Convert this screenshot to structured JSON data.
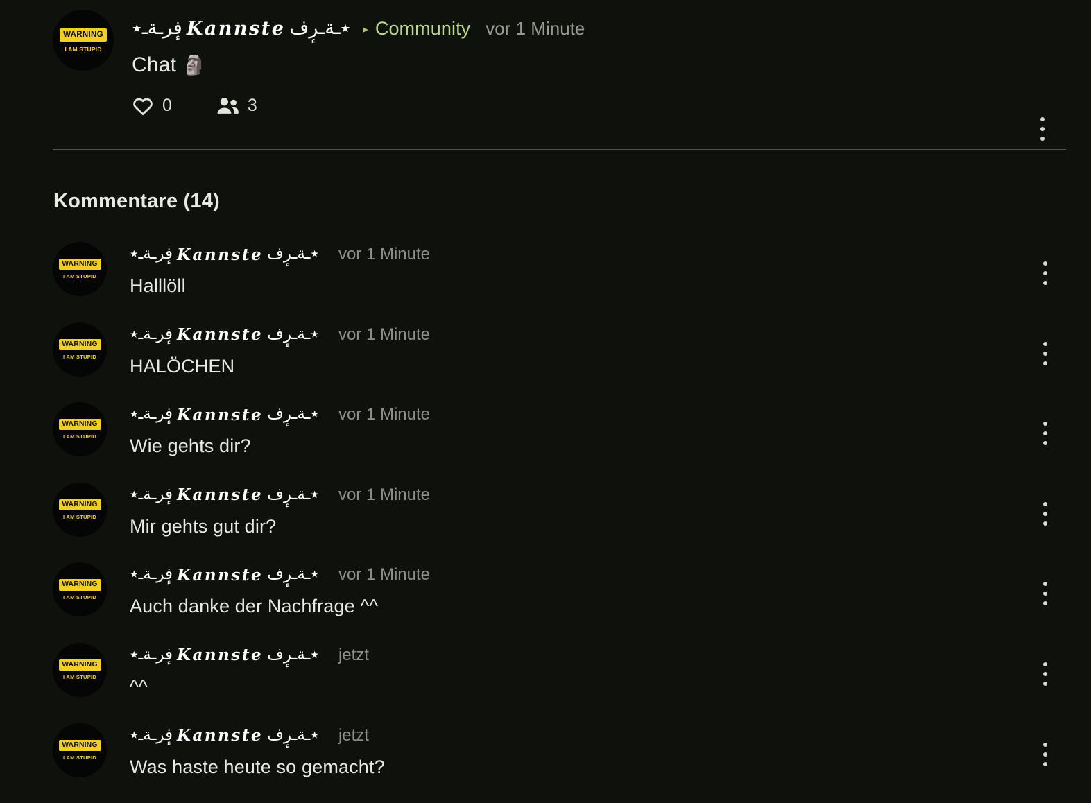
{
  "theme": {
    "background": "#0f110d",
    "text_primary": "#e8e8e4",
    "text_muted": "#9a9a93",
    "accent_green": "#b9d98c",
    "divider": "#4d524a",
    "avatar_yellow": "#f2d022"
  },
  "avatar": {
    "banner_text": "WARNING",
    "sub_text": "I AM STUPID"
  },
  "username": {
    "prefix_flourish": "فٕرـةـ٭",
    "core": "Kannste",
    "suffix_flourish": "٭ـةـرٕف"
  },
  "post": {
    "author": "Kannste",
    "caret": "▸",
    "community_label": "Community",
    "time": "vor 1 Minute",
    "text": "Chat",
    "emoji": "🗿",
    "likes_count": "0",
    "likes_icon": "heart-icon",
    "viewers_count": "3",
    "viewers_icon": "people-icon",
    "menu_icon": "kebab-menu-icon"
  },
  "comments_section": {
    "heading": "Kommentare (14)",
    "count": 14,
    "items": [
      {
        "author": "Kannste",
        "time": "vor 1 Minute",
        "text": "Halllöll"
      },
      {
        "author": "Kannste",
        "time": "vor 1 Minute",
        "text": "HALÖCHEN"
      },
      {
        "author": "Kannste",
        "time": "vor 1 Minute",
        "text": "Wie gehts dir?"
      },
      {
        "author": "Kannste",
        "time": "vor 1 Minute",
        "text": "Mir gehts gut dir?"
      },
      {
        "author": "Kannste",
        "time": "vor 1 Minute",
        "text": "Auch danke der Nachfrage ^^"
      },
      {
        "author": "Kannste",
        "time": "jetzt",
        "text": "^^"
      },
      {
        "author": "Kannste",
        "time": "jetzt",
        "text": "Was haste heute so gemacht?"
      }
    ]
  }
}
